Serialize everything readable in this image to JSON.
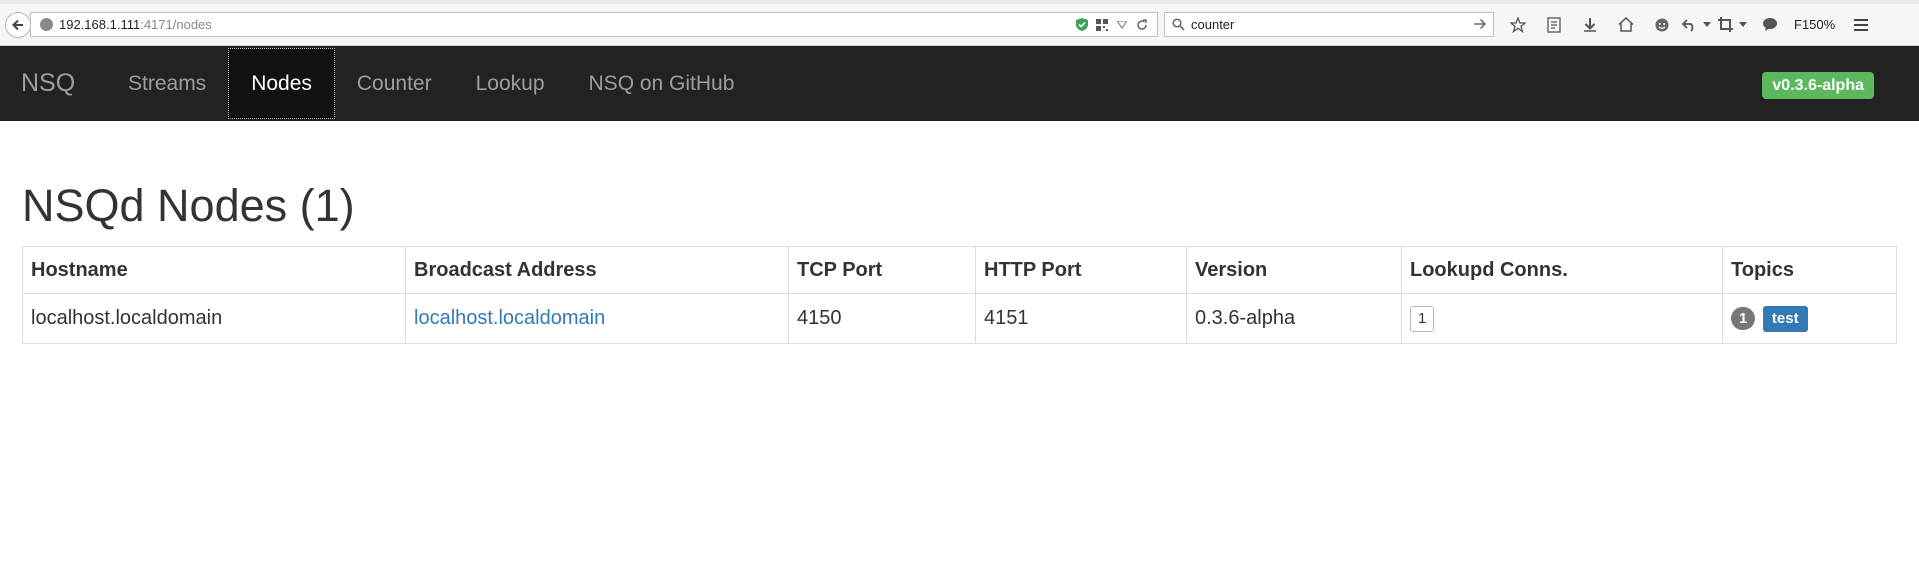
{
  "browser": {
    "url_host": "192.168.1.111",
    "url_rest": ":4171/nodes",
    "search_value": "counter",
    "zoom": "F150%"
  },
  "navbar": {
    "brand": "NSQ",
    "items": [
      {
        "label": "Streams",
        "active": false
      },
      {
        "label": "Nodes",
        "active": true
      },
      {
        "label": "Counter",
        "active": false
      },
      {
        "label": "Lookup",
        "active": false
      },
      {
        "label": "NSQ on GitHub",
        "active": false
      }
    ],
    "version": "v0.3.6-alpha"
  },
  "page": {
    "title": "NSQd Nodes (1)"
  },
  "table": {
    "columns": [
      "Hostname",
      "Broadcast Address",
      "TCP Port",
      "HTTP Port",
      "Version",
      "Lookupd Conns.",
      "Topics"
    ],
    "rows": [
      {
        "hostname": "localhost.localdomain",
        "broadcast_address": "localhost.localdomain",
        "tcp_port": "4150",
        "http_port": "4151",
        "version": "0.3.6-alpha",
        "lookupd_conns": "1",
        "topic_count": "1",
        "topics": [
          "test"
        ]
      }
    ]
  },
  "colors": {
    "navbar_bg": "#222222",
    "version_badge": "#5cb85c",
    "link": "#337ab7",
    "topic_label": "#337ab7",
    "count_badge": "#777777"
  }
}
